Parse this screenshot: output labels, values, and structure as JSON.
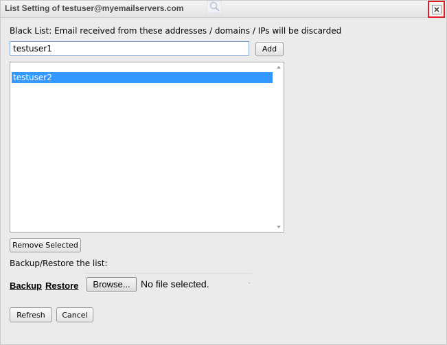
{
  "dialog": {
    "title": "List Setting of testuser@myemailservers.com",
    "close_icon": "close-icon"
  },
  "blacklist": {
    "description": "Black List: Email received from these addresses / domains / IPs will be discarded",
    "input_value": "testuser1",
    "add_label": "Add",
    "items": [
      "testuser2"
    ],
    "remove_label": "Remove Selected"
  },
  "backup": {
    "label": "Backup/Restore the list:",
    "backup_link": "Backup",
    "restore_link": "Restore",
    "browse_label": "Browse...",
    "file_status": "No file selected."
  },
  "footer": {
    "refresh_label": "Refresh",
    "cancel_label": "Cancel"
  },
  "colors": {
    "selection": "#3399ff",
    "close_highlight": "#e01d25"
  }
}
